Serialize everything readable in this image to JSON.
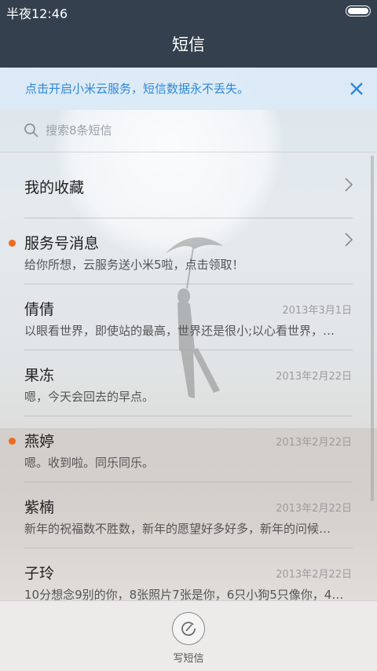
{
  "status_bar": {
    "time": "半夜12:46"
  },
  "header": {
    "title": "短信"
  },
  "banner": {
    "text": "点击开启小米云服务，短信数据永不丢失。",
    "accent_color": "#2f87d6"
  },
  "search": {
    "placeholder": "搜索8条短信"
  },
  "list": {
    "favorites": {
      "label": "我的收藏"
    },
    "service": {
      "name": "服务号消息",
      "snippet": "给你所想，云服务送小米5啦，点击领取！",
      "unread": true
    },
    "conversations": [
      {
        "name": "倩倩",
        "date": "2013年3月1日",
        "snippet": "以眼看世界，即使站的最高，世界还是很小;以心看世界，…",
        "unread": false
      },
      {
        "name": "果冻",
        "date": "2013年2月22日",
        "snippet": "嗯，今天会回去的早点。",
        "unread": false
      },
      {
        "name": "燕婷",
        "date": "2013年2月22日",
        "snippet": "嗯。收到啦。同乐同乐。",
        "unread": true
      },
      {
        "name": "紫楠",
        "date": "2013年2月22日",
        "snippet": "新年的祝福数不胜数，新年的愿望好多好多，新年的问候…",
        "unread": false
      },
      {
        "name": "子玲",
        "date": "2013年2月22日",
        "snippet": "10分想念9别的你，8张照片7张是你，6只小狗5只像你，4…",
        "unread": false
      }
    ]
  },
  "bottom_bar": {
    "compose_label": "写短信"
  },
  "colors": {
    "header_bg": "#34404d",
    "unread_dot": "#f06b1f"
  }
}
